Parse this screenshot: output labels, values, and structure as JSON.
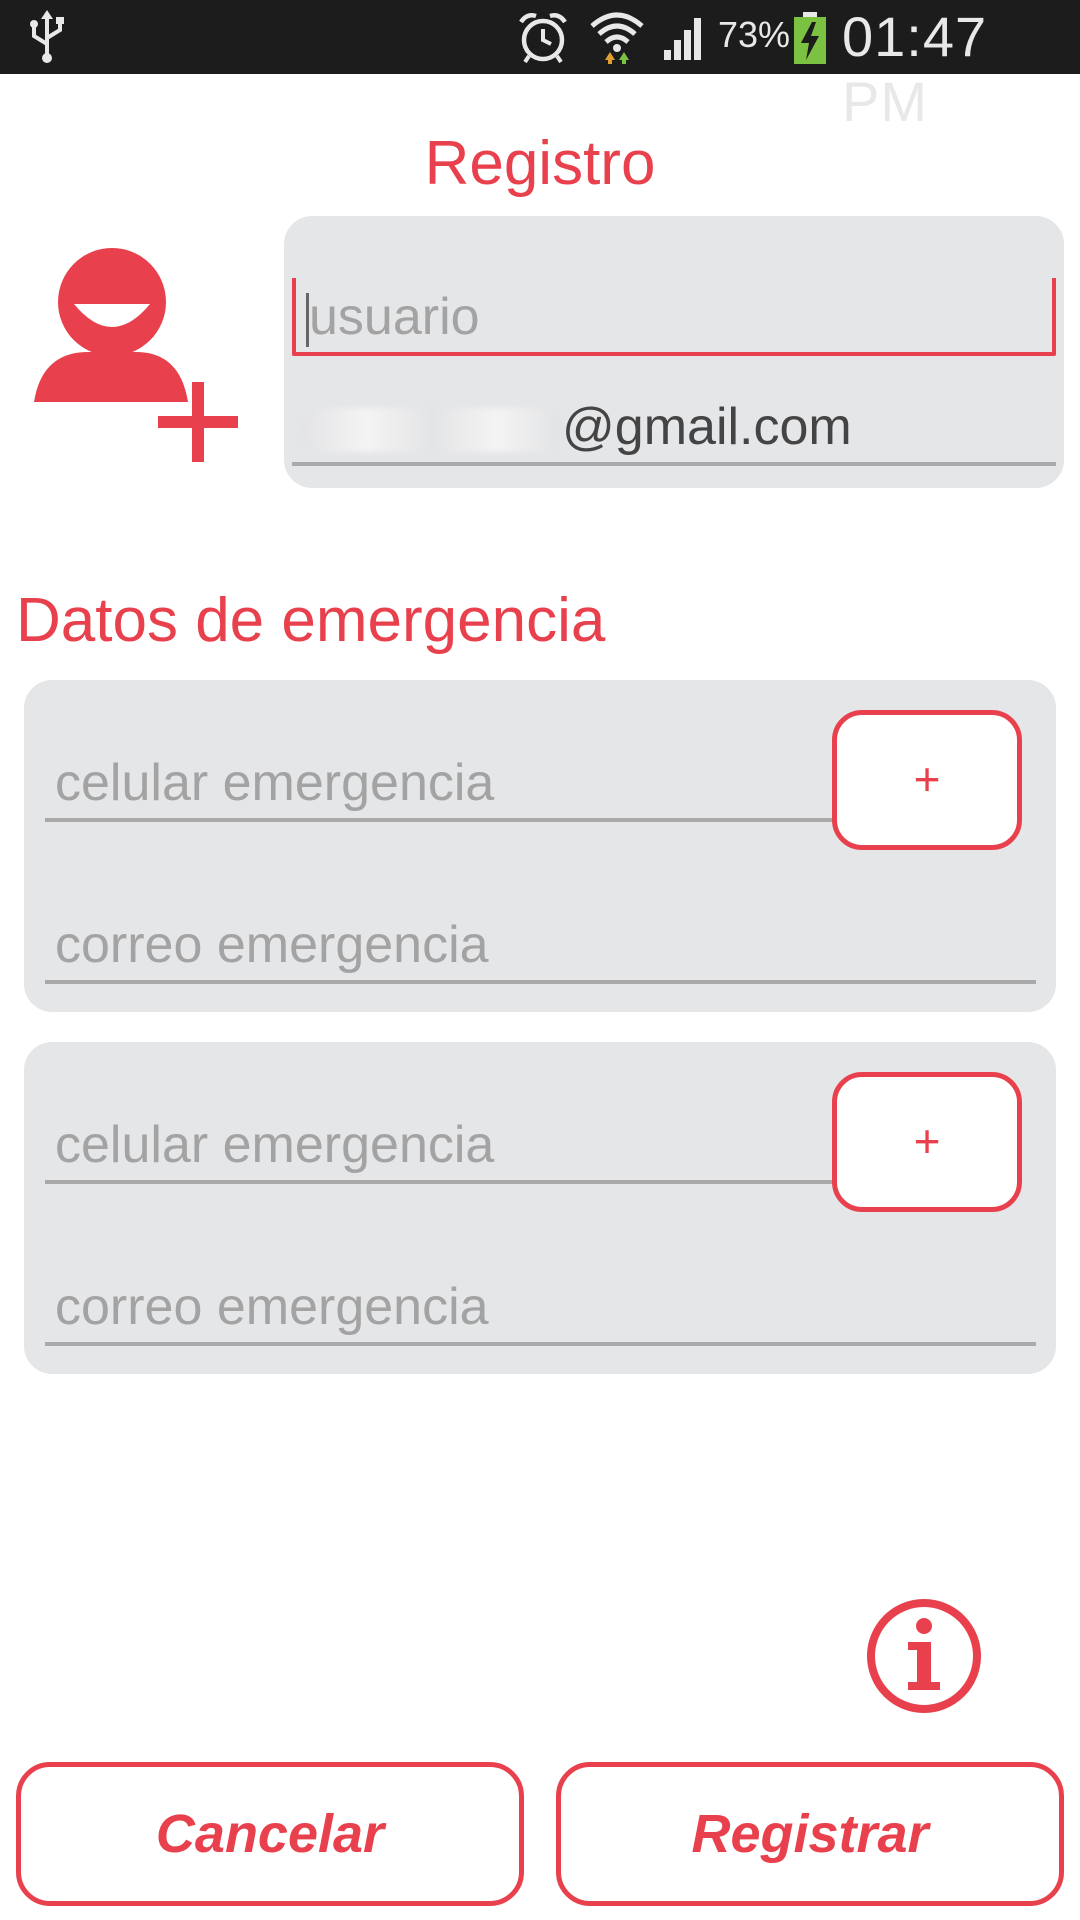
{
  "status_bar": {
    "battery": "73%",
    "time": "01:47 PM",
    "icons": [
      "usb-icon",
      "alarm-icon",
      "wifi-icon",
      "signal-icon",
      "battery-charging-icon"
    ]
  },
  "header": {
    "title": "Registro",
    "avatar_icon": "add-user-icon"
  },
  "user_form": {
    "username_placeholder": "usuario",
    "email_value": "@gmail.com"
  },
  "emergency": {
    "title": "Datos de emergencia",
    "contacts": [
      {
        "phone_placeholder": "celular emergencia",
        "email_placeholder": "correo emergencia",
        "add_label": "+"
      },
      {
        "phone_placeholder": "celular emergencia",
        "email_placeholder": "correo emergencia",
        "add_label": "+"
      }
    ]
  },
  "info_icon": "info-icon",
  "actions": {
    "cancel_label": "Cancelar",
    "register_label": "Registrar"
  },
  "colors": {
    "accent": "#e8414d",
    "card": "#e5e6e8",
    "status_bar": "#1c1c1c"
  }
}
